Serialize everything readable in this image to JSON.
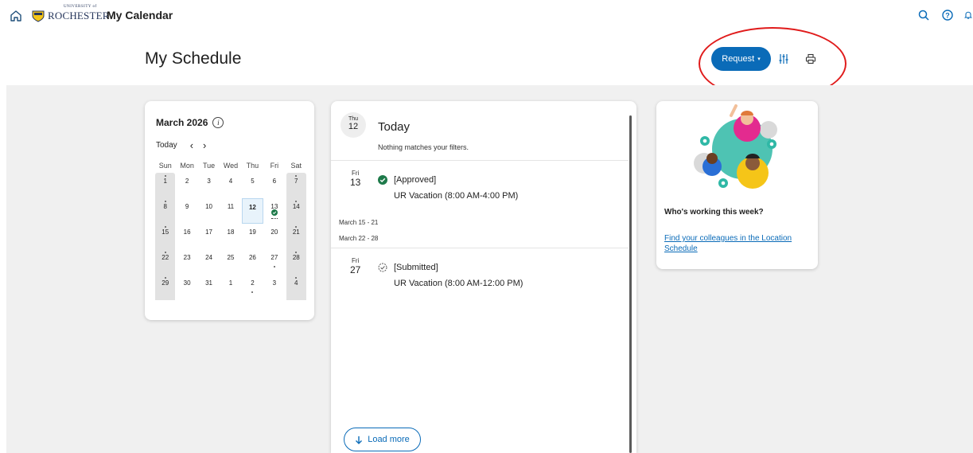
{
  "topbar": {
    "app_title": "My Calendar",
    "logo_text": "ROCHESTER",
    "logo_sub": "UNIVERSITY of",
    "icons": [
      "home-icon",
      "search-icon",
      "help-icon",
      "bell-icon"
    ]
  },
  "header": {
    "title": "My Schedule",
    "request_label": "Request",
    "request_caret": "▾"
  },
  "calendar": {
    "month_label": "March 2026",
    "today_label": "Today",
    "prev": "‹",
    "next": "›",
    "weekdays": [
      "Sun",
      "Mon",
      "Tue",
      "Wed",
      "Thu",
      "Fri",
      "Sat"
    ],
    "weeks": [
      [
        "1",
        "2",
        "3",
        "4",
        "5",
        "6",
        "7"
      ],
      [
        "8",
        "9",
        "10",
        "11",
        "12",
        "13",
        "14"
      ],
      [
        "15",
        "16",
        "17",
        "18",
        "19",
        "20",
        "21"
      ],
      [
        "22",
        "23",
        "24",
        "25",
        "26",
        "27",
        "28"
      ],
      [
        "29",
        "30",
        "31",
        "1",
        "2",
        "3",
        "4"
      ]
    ],
    "today_date": "12"
  },
  "schedule": {
    "today": {
      "dow": "Thu",
      "day": "12",
      "title": "Today",
      "subtitle": "Nothing matches your filters."
    },
    "events": [
      {
        "dow": "Fri",
        "day": "13",
        "status": "[Approved]",
        "detail": "UR Vacation (8:00 AM-4:00 PM)"
      },
      {
        "dow": "Fri",
        "day": "27",
        "status": "[Submitted]",
        "detail": "UR Vacation (8:00 AM-12:00 PM)"
      }
    ],
    "weeks": [
      "March 15 - 21",
      "March 22 - 28"
    ],
    "load_more": "Load more"
  },
  "who": {
    "title": "Who's working this week?",
    "link": "Find your colleagues in the Location Schedule"
  },
  "colors": {
    "accent": "#0a6bb8",
    "approved": "#1e7a4a",
    "annotation": "#e01b1b"
  }
}
